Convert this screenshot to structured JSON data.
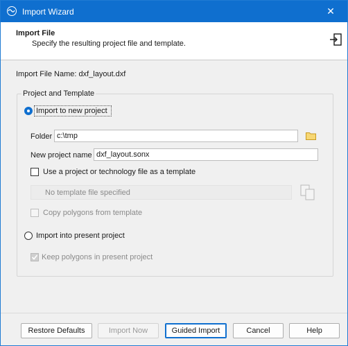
{
  "window": {
    "title": "Import Wizard"
  },
  "header": {
    "title": "Import File",
    "subtitle": "Specify the resulting project file and template."
  },
  "import_file": {
    "label": "Import File Name:",
    "name": "dxf_layout.dxf"
  },
  "group": {
    "title": "Project and Template",
    "new_project_radio": "Import to new project",
    "folder_label": "Folder",
    "folder_value": "c:\\tmp",
    "project_name_label": "New project name",
    "project_name_value": "dxf_layout.sonx",
    "use_template_checkbox": "Use a project or technology file as a template",
    "template_placeholder": "No template file specified",
    "copy_polygons_checkbox": "Copy polygons from template",
    "present_project_radio": "Import into present project",
    "keep_polygons_checkbox": "Keep polygons in present project"
  },
  "buttons": {
    "restore": "Restore Defaults",
    "import_now": "Import Now",
    "guided": "Guided Import",
    "cancel": "Cancel",
    "help": "Help"
  },
  "colors": {
    "accent": "#0f6fcf",
    "folder": "#e8b53a"
  }
}
